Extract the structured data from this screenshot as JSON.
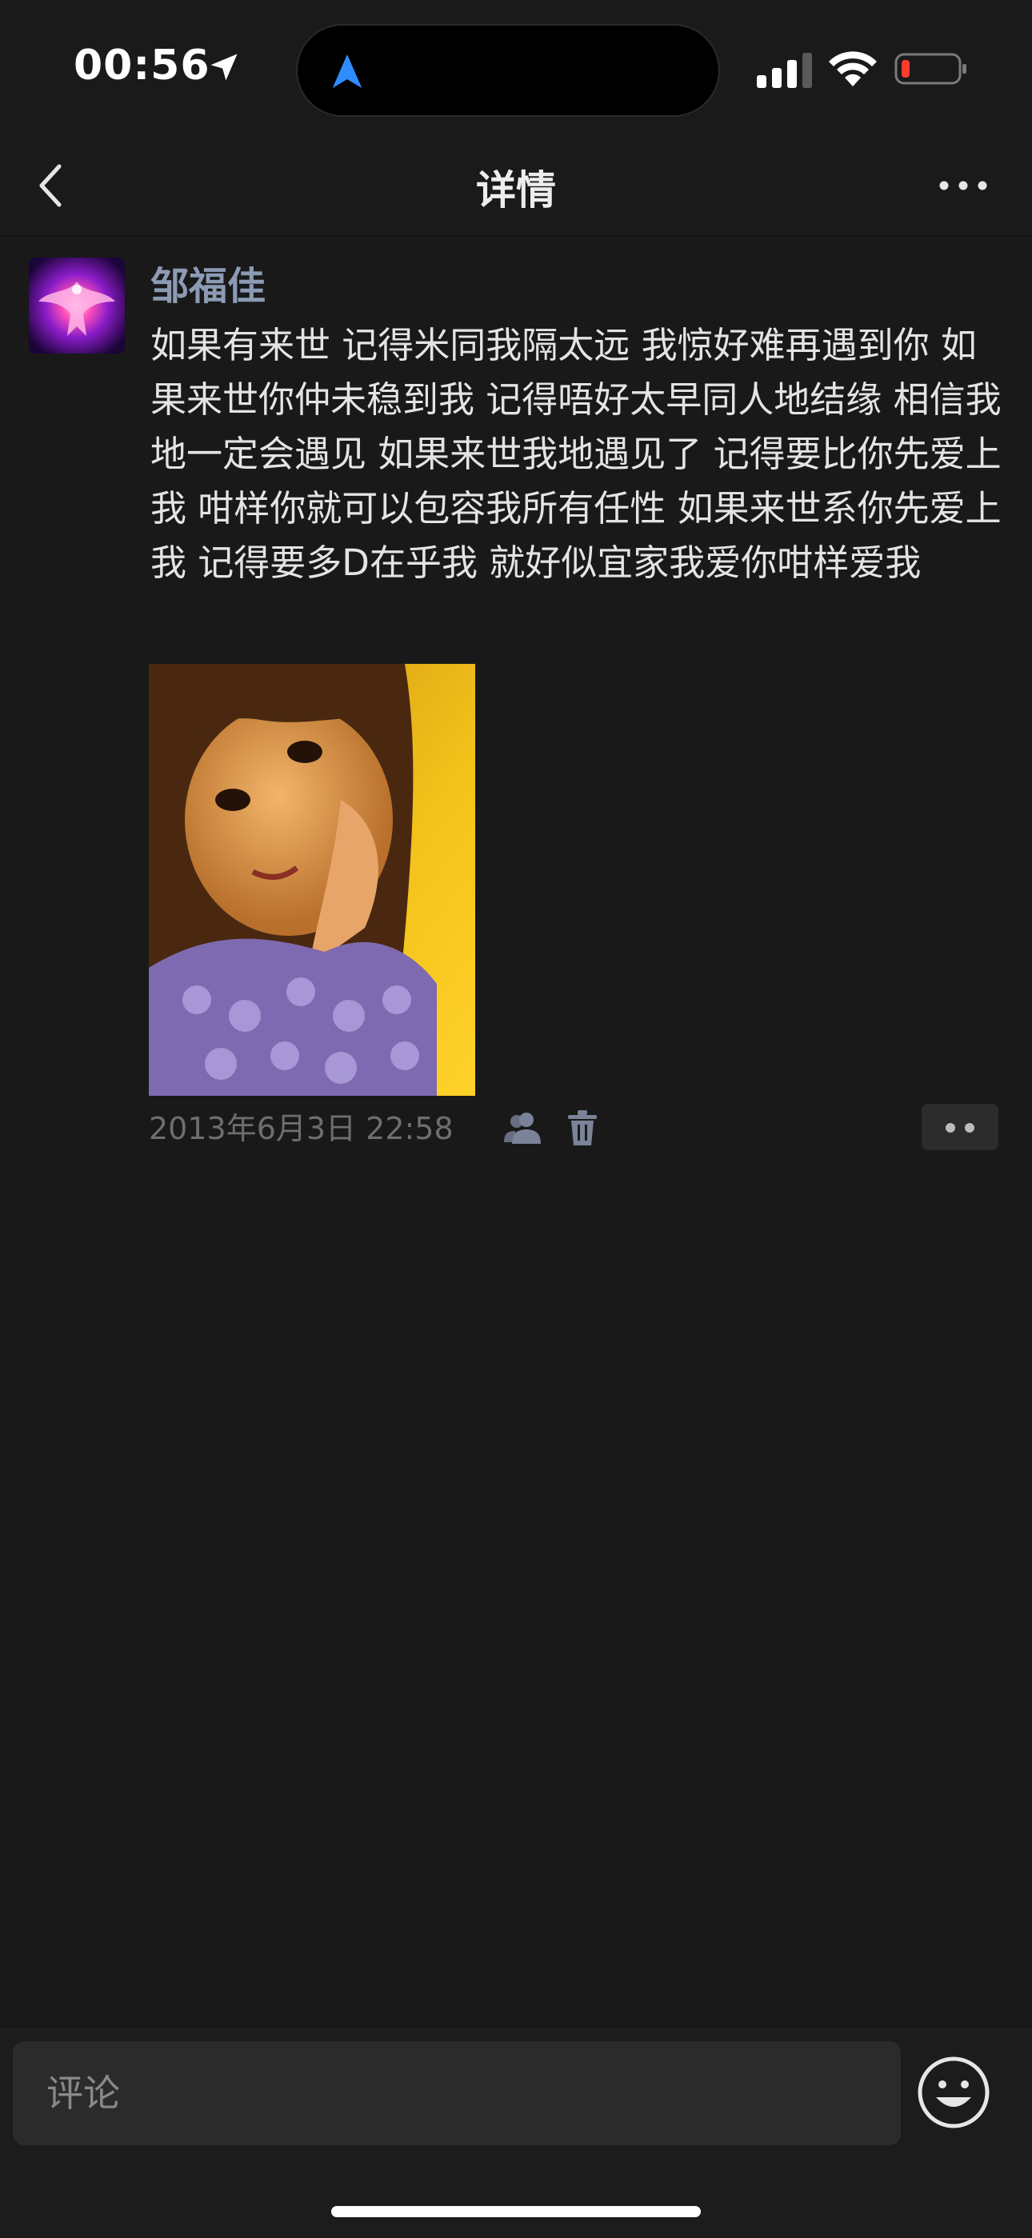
{
  "status_bar": {
    "time": "00:56"
  },
  "nav": {
    "title": "详情"
  },
  "post": {
    "username": "邹福佳",
    "text": "如果有来世 记得米同我隔太远 我惊好难再遇到你 如果来世你仲未稳到我 记得唔好太早同人地结缘 相信我地一定会遇见 如果来世我地遇见了 记得要比你先爱上我 咁样你就可以包容我所有任性 如果来世系你先爱上我 记得要多D在乎我 就好似宜家我爱你咁样爱我",
    "timestamp": "2013年6月3日 22:58"
  },
  "comment": {
    "placeholder": "评论"
  },
  "colors": {
    "background": "#191919",
    "username": "#8c9ab4",
    "accent_blue": "#2f8cff",
    "battery_low": "#ff3b30"
  },
  "icons": [
    "location-arrow-icon",
    "navigation-icon",
    "signal-icon",
    "wifi-icon",
    "battery-icon",
    "back-chevron-icon",
    "more-dots-icon",
    "friends-visibility-icon",
    "trash-icon",
    "comment-dots-icon",
    "emoji-icon"
  ]
}
